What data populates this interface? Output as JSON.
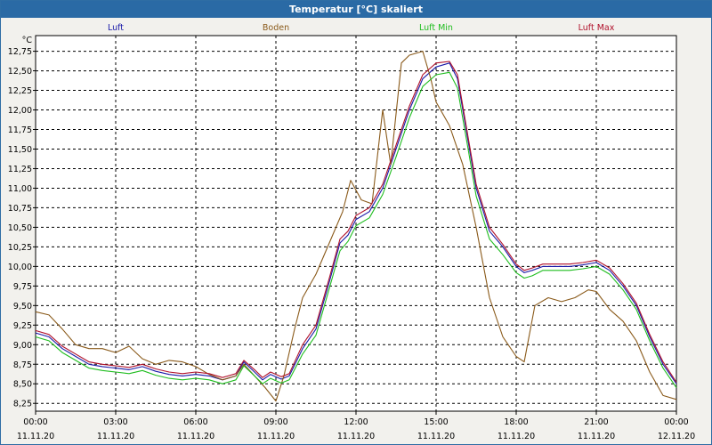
{
  "title": "Temperatur [°C] skaliert",
  "colors": {
    "title_bar": "#2a6aa5",
    "background": "#f2f1ed",
    "plot_bg": "#ffffff"
  },
  "chart_data": {
    "type": "line",
    "title": "Temperatur [°C] skaliert",
    "ylabel": "°C",
    "ylim": [
      8.15,
      12.95
    ],
    "yticks": [
      "8,25",
      "8,50",
      "8,75",
      "9,00",
      "9,25",
      "9,50",
      "9,75",
      "10,00",
      "10,25",
      "10,50",
      "10,75",
      "11,00",
      "11,25",
      "11,50",
      "11,75",
      "12,00",
      "12,25",
      "12,50",
      "12,75"
    ],
    "xlim": [
      0,
      24
    ],
    "xticks": [
      {
        "hour": 0,
        "time": "00:00",
        "date": "11.11.20"
      },
      {
        "hour": 3,
        "time": "03:00",
        "date": "11.11.20"
      },
      {
        "hour": 6,
        "time": "06:00",
        "date": "11.11.20"
      },
      {
        "hour": 9,
        "time": "09:00",
        "date": "11.11.20"
      },
      {
        "hour": 12,
        "time": "12:00",
        "date": "11.11.20"
      },
      {
        "hour": 15,
        "time": "15:00",
        "date": "11.11.20"
      },
      {
        "hour": 18,
        "time": "18:00",
        "date": "11.11.20"
      },
      {
        "hour": 21,
        "time": "21:00",
        "date": "11.11.20"
      },
      {
        "hour": 24,
        "time": "00:00",
        "date": "12.11.20"
      }
    ],
    "grid": true,
    "legend_position": "top",
    "series": [
      {
        "name": "Luft",
        "color": "#1a1aa8",
        "points": [
          [
            0,
            9.15
          ],
          [
            0.5,
            9.1
          ],
          [
            1,
            8.95
          ],
          [
            1.5,
            8.85
          ],
          [
            2,
            8.75
          ],
          [
            2.5,
            8.72
          ],
          [
            3,
            8.7
          ],
          [
            3.5,
            8.68
          ],
          [
            4,
            8.72
          ],
          [
            4.5,
            8.66
          ],
          [
            5,
            8.62
          ],
          [
            5.5,
            8.6
          ],
          [
            6,
            8.62
          ],
          [
            6.5,
            8.6
          ],
          [
            7,
            8.55
          ],
          [
            7.5,
            8.6
          ],
          [
            7.8,
            8.78
          ],
          [
            8.2,
            8.65
          ],
          [
            8.5,
            8.55
          ],
          [
            8.8,
            8.62
          ],
          [
            9.2,
            8.56
          ],
          [
            9.5,
            8.6
          ],
          [
            10,
            8.95
          ],
          [
            10.5,
            9.2
          ],
          [
            11,
            9.8
          ],
          [
            11.4,
            10.3
          ],
          [
            11.7,
            10.4
          ],
          [
            12,
            10.6
          ],
          [
            12.5,
            10.7
          ],
          [
            13,
            11.0
          ],
          [
            13.5,
            11.5
          ],
          [
            14,
            12.0
          ],
          [
            14.5,
            12.4
          ],
          [
            15,
            12.55
          ],
          [
            15.5,
            12.6
          ],
          [
            15.8,
            12.4
          ],
          [
            16.2,
            11.6
          ],
          [
            16.5,
            11.0
          ],
          [
            17,
            10.45
          ],
          [
            17.5,
            10.25
          ],
          [
            18,
            10.0
          ],
          [
            18.3,
            9.92
          ],
          [
            18.6,
            9.95
          ],
          [
            19,
            10.0
          ],
          [
            19.5,
            10.0
          ],
          [
            20,
            10.0
          ],
          [
            20.5,
            10.02
          ],
          [
            21,
            10.05
          ],
          [
            21.5,
            9.95
          ],
          [
            22,
            9.75
          ],
          [
            22.5,
            9.5
          ],
          [
            23,
            9.1
          ],
          [
            23.5,
            8.75
          ],
          [
            24,
            8.5
          ]
        ]
      },
      {
        "name": "Boden",
        "color": "#8a5a1a",
        "points": [
          [
            0,
            9.42
          ],
          [
            0.5,
            9.38
          ],
          [
            1,
            9.2
          ],
          [
            1.5,
            9.0
          ],
          [
            2,
            8.95
          ],
          [
            2.5,
            8.95
          ],
          [
            3,
            8.9
          ],
          [
            3.5,
            8.98
          ],
          [
            4,
            8.82
          ],
          [
            4.5,
            8.75
          ],
          [
            5,
            8.8
          ],
          [
            5.5,
            8.78
          ],
          [
            6,
            8.72
          ],
          [
            6.5,
            8.62
          ],
          [
            7,
            8.55
          ],
          [
            7.5,
            8.6
          ],
          [
            7.8,
            8.75
          ],
          [
            8.2,
            8.6
          ],
          [
            8.6,
            8.45
          ],
          [
            9,
            8.28
          ],
          [
            9.3,
            8.6
          ],
          [
            9.7,
            9.2
          ],
          [
            10,
            9.6
          ],
          [
            10.5,
            9.9
          ],
          [
            11,
            10.3
          ],
          [
            11.5,
            10.7
          ],
          [
            11.8,
            11.1
          ],
          [
            12.2,
            10.85
          ],
          [
            12.6,
            10.8
          ],
          [
            13,
            12.0
          ],
          [
            13.3,
            11.3
          ],
          [
            13.7,
            12.6
          ],
          [
            14,
            12.7
          ],
          [
            14.5,
            12.75
          ],
          [
            14.8,
            12.4
          ],
          [
            15,
            12.1
          ],
          [
            15.5,
            11.8
          ],
          [
            16,
            11.3
          ],
          [
            16.5,
            10.5
          ],
          [
            17,
            9.6
          ],
          [
            17.5,
            9.1
          ],
          [
            18,
            8.85
          ],
          [
            18.3,
            8.78
          ],
          [
            18.7,
            9.5
          ],
          [
            19.2,
            9.6
          ],
          [
            19.7,
            9.55
          ],
          [
            20.2,
            9.6
          ],
          [
            20.7,
            9.7
          ],
          [
            21,
            9.68
          ],
          [
            21.5,
            9.45
          ],
          [
            22,
            9.3
          ],
          [
            22.5,
            9.05
          ],
          [
            23,
            8.65
          ],
          [
            23.5,
            8.35
          ],
          [
            24,
            8.3
          ]
        ]
      },
      {
        "name": "Luft Min",
        "color": "#1fbd1f",
        "points": [
          [
            0,
            9.1
          ],
          [
            0.5,
            9.05
          ],
          [
            1,
            8.9
          ],
          [
            1.5,
            8.8
          ],
          [
            2,
            8.7
          ],
          [
            2.5,
            8.67
          ],
          [
            3,
            8.65
          ],
          [
            3.5,
            8.63
          ],
          [
            4,
            8.67
          ],
          [
            4.5,
            8.61
          ],
          [
            5,
            8.57
          ],
          [
            5.5,
            8.55
          ],
          [
            6,
            8.57
          ],
          [
            6.5,
            8.55
          ],
          [
            7,
            8.5
          ],
          [
            7.5,
            8.55
          ],
          [
            7.8,
            8.73
          ],
          [
            8.2,
            8.6
          ],
          [
            8.5,
            8.5
          ],
          [
            8.8,
            8.57
          ],
          [
            9.2,
            8.51
          ],
          [
            9.5,
            8.55
          ],
          [
            10,
            8.88
          ],
          [
            10.5,
            9.12
          ],
          [
            11,
            9.72
          ],
          [
            11.4,
            10.2
          ],
          [
            11.7,
            10.32
          ],
          [
            12,
            10.52
          ],
          [
            12.5,
            10.62
          ],
          [
            13,
            10.92
          ],
          [
            13.5,
            11.4
          ],
          [
            14,
            11.9
          ],
          [
            14.5,
            12.3
          ],
          [
            15,
            12.45
          ],
          [
            15.5,
            12.48
          ],
          [
            15.8,
            12.28
          ],
          [
            16.2,
            11.5
          ],
          [
            16.5,
            10.9
          ],
          [
            17,
            10.35
          ],
          [
            17.5,
            10.15
          ],
          [
            18,
            9.92
          ],
          [
            18.3,
            9.85
          ],
          [
            18.6,
            9.88
          ],
          [
            19,
            9.95
          ],
          [
            19.5,
            9.95
          ],
          [
            20,
            9.95
          ],
          [
            20.5,
            9.97
          ],
          [
            21,
            10.0
          ],
          [
            21.5,
            9.9
          ],
          [
            22,
            9.7
          ],
          [
            22.5,
            9.45
          ],
          [
            23,
            9.05
          ],
          [
            23.5,
            8.7
          ],
          [
            24,
            8.45
          ]
        ]
      },
      {
        "name": "Luft Max",
        "color": "#b0102a",
        "points": [
          [
            0,
            9.18
          ],
          [
            0.5,
            9.13
          ],
          [
            1,
            8.98
          ],
          [
            1.5,
            8.88
          ],
          [
            2,
            8.78
          ],
          [
            2.5,
            8.75
          ],
          [
            3,
            8.73
          ],
          [
            3.5,
            8.71
          ],
          [
            4,
            8.75
          ],
          [
            4.5,
            8.69
          ],
          [
            5,
            8.65
          ],
          [
            5.5,
            8.63
          ],
          [
            6,
            8.65
          ],
          [
            6.5,
            8.63
          ],
          [
            7,
            8.58
          ],
          [
            7.5,
            8.63
          ],
          [
            7.8,
            8.8
          ],
          [
            8.2,
            8.68
          ],
          [
            8.5,
            8.58
          ],
          [
            8.8,
            8.65
          ],
          [
            9.2,
            8.59
          ],
          [
            9.5,
            8.63
          ],
          [
            10,
            9.0
          ],
          [
            10.5,
            9.25
          ],
          [
            11,
            9.85
          ],
          [
            11.4,
            10.35
          ],
          [
            11.7,
            10.45
          ],
          [
            12,
            10.65
          ],
          [
            12.5,
            10.75
          ],
          [
            13,
            11.05
          ],
          [
            13.5,
            11.55
          ],
          [
            14,
            12.05
          ],
          [
            14.5,
            12.45
          ],
          [
            15,
            12.6
          ],
          [
            15.5,
            12.62
          ],
          [
            15.8,
            12.45
          ],
          [
            16.2,
            11.65
          ],
          [
            16.5,
            11.05
          ],
          [
            17,
            10.5
          ],
          [
            17.5,
            10.28
          ],
          [
            18,
            10.03
          ],
          [
            18.3,
            9.95
          ],
          [
            18.6,
            9.98
          ],
          [
            19,
            10.03
          ],
          [
            19.5,
            10.03
          ],
          [
            20,
            10.03
          ],
          [
            20.5,
            10.05
          ],
          [
            21,
            10.08
          ],
          [
            21.5,
            9.98
          ],
          [
            22,
            9.78
          ],
          [
            22.5,
            9.53
          ],
          [
            23,
            9.13
          ],
          [
            23.5,
            8.78
          ],
          [
            24,
            8.52
          ]
        ]
      }
    ]
  }
}
